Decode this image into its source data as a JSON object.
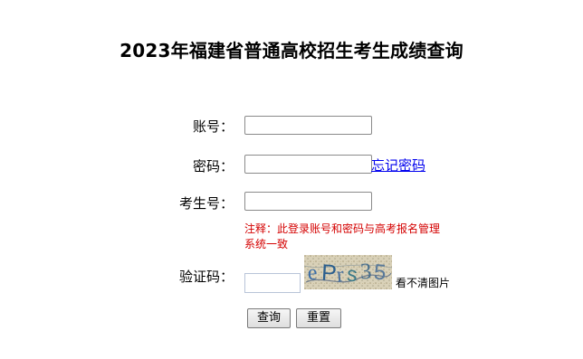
{
  "page": {
    "title": "2023年福建省普通高校招生考生成绩查询"
  },
  "form": {
    "account_label": "账号：",
    "account_value": "",
    "password_label": "密码：",
    "password_value": "",
    "forgot_password_link": "忘记密码",
    "exam_number_label": "考生号：",
    "exam_number_value": "",
    "note": "注释：此登录账号和密码与高考报名管理系统一致",
    "captcha_label": "验证码：",
    "captcha_value": "",
    "captcha_image_text": "ePrs35",
    "captcha_refresh_text": "看不清图片",
    "query_button": "查询",
    "reset_button": "重置"
  },
  "colors": {
    "note": "#d40000",
    "link": "#0000ee"
  }
}
